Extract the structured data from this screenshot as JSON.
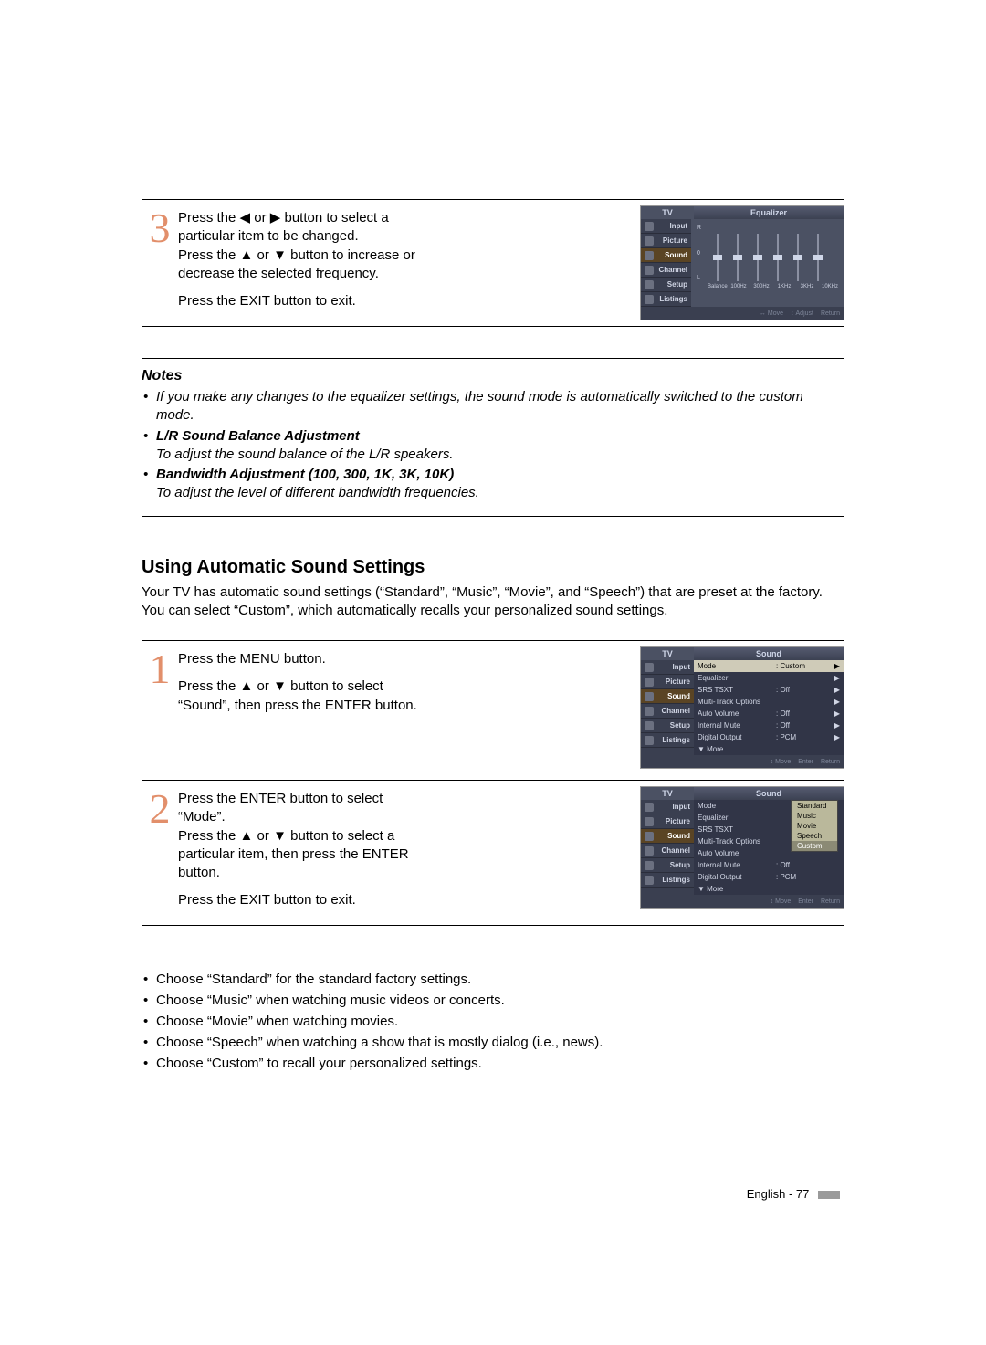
{
  "step3": {
    "num": "3",
    "p1_a": "Press the ",
    "p1_b": " or ",
    "p1_c": " button to select a particular item to be changed.",
    "p2_a": "Press the ",
    "p2_b": " or ",
    "p2_c": " button to increase or decrease the selected frequency.",
    "p3": "Press the EXIT button to exit."
  },
  "notes": {
    "heading": "Notes",
    "n1": "If you make any changes to the equalizer settings, the sound mode is automatically switched to the custom mode.",
    "n2_title": "L/R Sound Balance Adjustment",
    "n2_body": "To adjust the sound balance of the L/R speakers.",
    "n3_title": "Bandwidth Adjustment (100, 300, 1K, 3K, 10K)",
    "n3_body": "To adjust the level of different bandwidth frequencies."
  },
  "section_heading": "Using Automatic Sound Settings",
  "intro": "Your TV has automatic sound settings (“Standard”, “Music”, “Movie”, and “Speech”) that are preset at the factory. You can select “Custom”, which automatically recalls your personalized sound settings.",
  "steps": {
    "s1": {
      "num": "1",
      "p1": "Press the MENU button.",
      "p2_a": "Press the ",
      "p2_b": " or ",
      "p2_c": " button to select “Sound”, then press the ENTER button."
    },
    "s2": {
      "num": "2",
      "p1": "Press the ENTER button to select “Mode”.",
      "p2_a": "Press the ",
      "p2_b": " or ",
      "p2_c": " button to select a particular item, then press the ENTER button.",
      "p3": "Press the EXIT button to exit."
    }
  },
  "choices": {
    "c1": "Choose “Standard” for the standard factory settings.",
    "c2": "Choose “Music” when watching music videos or concerts.",
    "c3": "Choose “Movie” when watching movies.",
    "c4": "Choose “Speech” when watching a show that is mostly dialog (i.e., news).",
    "c5": "Choose “Custom” to recall your personalized settings."
  },
  "footer": "English - 77",
  "osd": {
    "tv": "TV",
    "sidebar": {
      "input": "Input",
      "picture": "Picture",
      "sound": "Sound",
      "channel": "Channel",
      "setup": "Setup",
      "listings": "Listings"
    },
    "footer": {
      "move": "Move",
      "adjust": "Adjust",
      "enter": "Enter",
      "return": "Return"
    },
    "eq": {
      "title": "Equalizer",
      "axis_r": "R",
      "axis_0": "0",
      "axis_l": "L",
      "labels": [
        "Balance",
        "100Hz",
        "300Hz",
        "1KHz",
        "3KHz",
        "10KHz"
      ]
    },
    "sound": {
      "title": "Sound",
      "rows": {
        "mode": "Mode",
        "mode_v": ": Custom",
        "eq": "Equalizer",
        "srs": "SRS TSXT",
        "srs_v": ": Off",
        "mto": "Multi-Track Options",
        "av": "Auto Volume",
        "av_v": ": Off",
        "im": "Internal Mute",
        "im_v": ": Off",
        "do": "Digital Output",
        "do_v": ": PCM",
        "more": "▼ More"
      }
    },
    "sound2": {
      "rows": {
        "im_v": ": Off",
        "do_v": ": PCM"
      },
      "popup": [
        "Standard",
        "Music",
        "Movie",
        "Speech",
        "Custom"
      ]
    }
  },
  "glyph": {
    "left": "◀",
    "right": "▶",
    "up": "▲",
    "down": "▼",
    "lr": "↔",
    "ud": "↕"
  }
}
